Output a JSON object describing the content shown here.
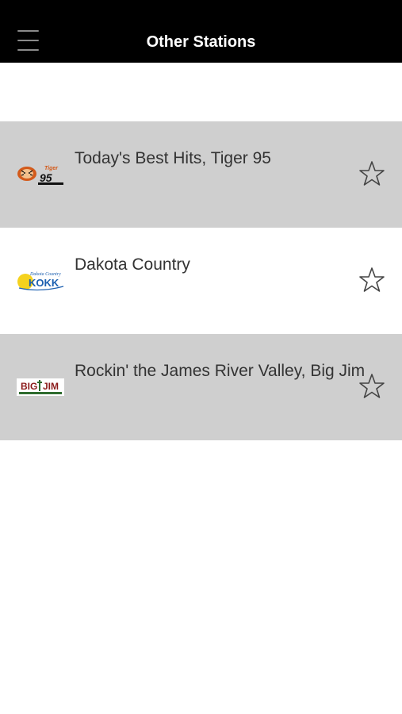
{
  "header": {
    "title": "Other Stations",
    "menu_icon": "hamburger-menu-icon",
    "background": "#000000"
  },
  "stations": [
    {
      "name": "Today's Best Hits, Tiger 95",
      "logo": "tiger-95-logo",
      "logo_text": "Tiger 95",
      "favorite": false,
      "favorite_icon": "star-outline-icon",
      "row_color": "#cfcfcf"
    },
    {
      "name": "Dakota Country",
      "logo": "dakota-country-kokk-logo",
      "logo_text": "Dakota Country KOKK",
      "favorite": false,
      "favorite_icon": "star-outline-icon",
      "row_color": "#ffffff"
    },
    {
      "name": "Rockin' the James River Valley, Big Jim",
      "logo": "big-jim-logo",
      "logo_text": "Big Jim",
      "favorite": false,
      "favorite_icon": "star-outline-icon",
      "row_color": "#cfcfcf"
    }
  ]
}
